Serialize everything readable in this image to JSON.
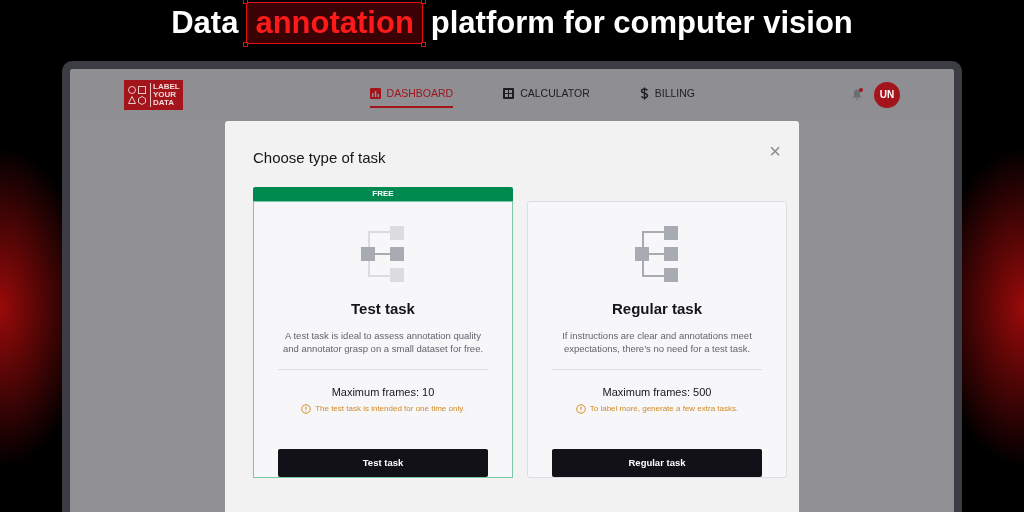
{
  "headline": {
    "before": "Data",
    "highlight": "annotation",
    "after": "platform for computer vision"
  },
  "header": {
    "logo_text": [
      "LABEL",
      "YOUR",
      "DATA"
    ],
    "nav": [
      {
        "label": "DASHBOARD",
        "kind": "dashboard",
        "selected": true
      },
      {
        "label": "CALCULATOR",
        "kind": "calculator",
        "selected": false
      },
      {
        "label": "BILLING",
        "kind": "billing",
        "selected": false
      }
    ],
    "notification": true,
    "avatar": "UN"
  },
  "dialog": {
    "title": "Choose type of task",
    "close": "×",
    "options": [
      {
        "kind": "test",
        "badge": "FREE",
        "selected": true,
        "title": "Test task",
        "description": "A test task is ideal to assess annotation quality and annotator grasp on a small dataset for free.",
        "frames": "Maximum frames: 10",
        "note": "The test task is intended for one time only.",
        "button": "Test task"
      },
      {
        "kind": "regular",
        "selected": false,
        "title": "Regular task",
        "description": "If instructions are clear and annotations meet expectations, there’s no need for a test task.",
        "frames": "Maximum frames: 500",
        "note": "To label more, generate a few extra tasks.",
        "button": "Regular task"
      }
    ]
  }
}
